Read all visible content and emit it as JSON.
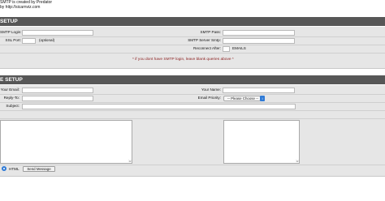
{
  "credits": {
    "line1": "SMTP is created by Predator",
    "line2": "by http://sicarnviz.com"
  },
  "smtp_section": {
    "header": "SETUP",
    "login_label": "SMTP Login:",
    "pass_label": "SMTP Pass:",
    "ssl_port_label": "SSL Port:",
    "ssl_port_placeholder": "(optional)",
    "server_label": "SMTP Server Smtp:",
    "reconnect_label": "Reconnect After:",
    "reconnect_unit": "EMAILS",
    "note": "* if you dont have SMTP login, leave blank queries above *"
  },
  "message_section": {
    "header": "E SETUP",
    "email_label": "Your Email:",
    "name_label": "Your Name:",
    "reply_label": "Reply-To:",
    "priority_label": "Email Priority:",
    "priority_selected": "-- Please Choose --",
    "subject_label": "Subject:",
    "html_label": "HTML",
    "send_button": "Send Message"
  }
}
